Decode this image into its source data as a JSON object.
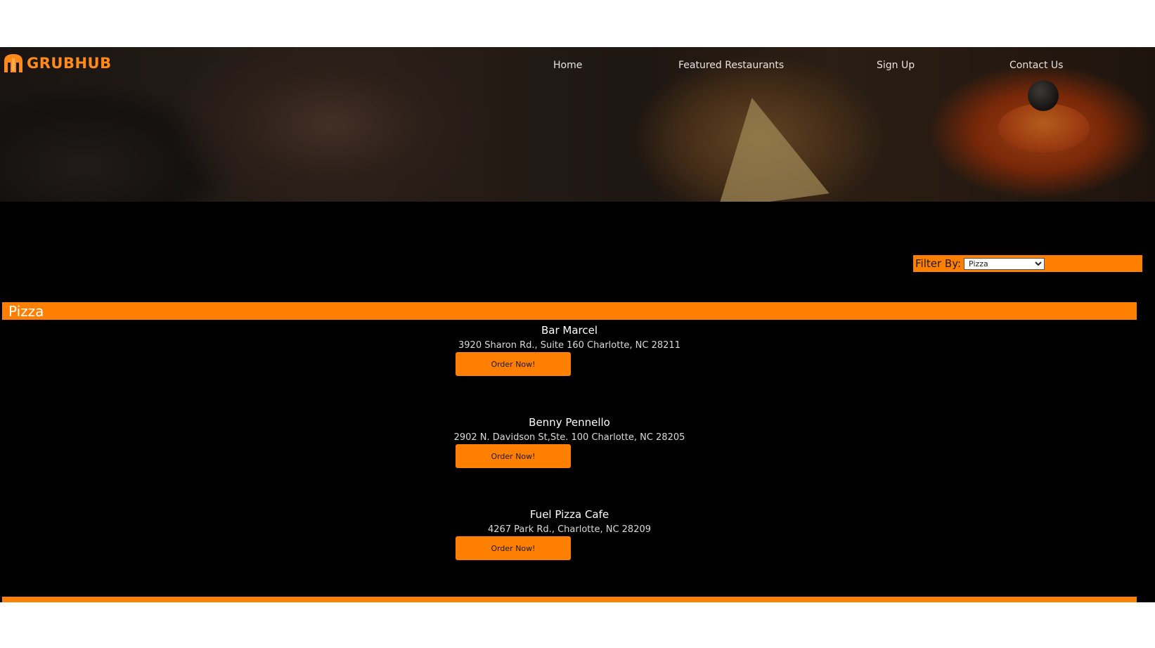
{
  "brand": {
    "name": "GRUBHUB",
    "accent_color": "#ff7f00"
  },
  "nav": {
    "items": [
      {
        "label": "Home"
      },
      {
        "label": "Featured Restaurants"
      },
      {
        "label": "Sign Up"
      },
      {
        "label": "Contact Us"
      }
    ]
  },
  "filter": {
    "label": "Filter By:",
    "selected": "Pizza"
  },
  "category": {
    "title": "Pizza",
    "restaurants": [
      {
        "name": "Bar Marcel",
        "address": "3920 Sharon Rd., Suite 160 Charlotte, NC 28211",
        "button": "Order Now!"
      },
      {
        "name": "Benny Pennello",
        "address": "2902 N. Davidson St,Ste. 100 Charlotte, NC 28205",
        "button": "Order Now!"
      },
      {
        "name": "Fuel Pizza Cafe",
        "address": "4267 Park Rd., Charlotte, NC 28209",
        "button": "Order Now!"
      }
    ]
  }
}
